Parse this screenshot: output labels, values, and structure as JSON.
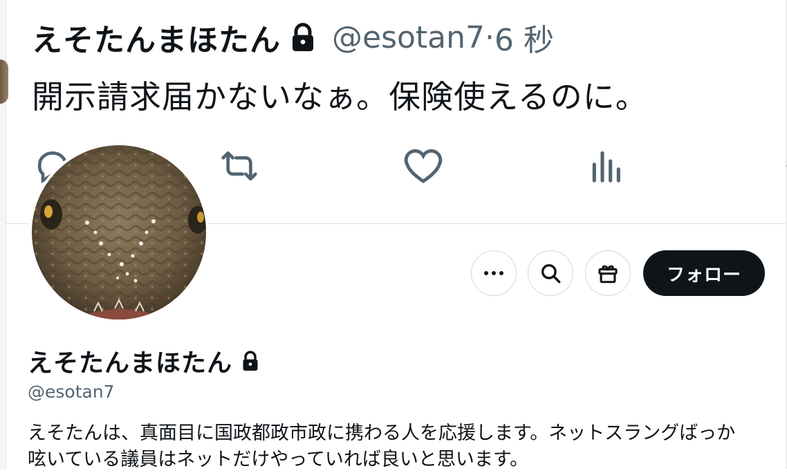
{
  "tweet": {
    "display_name": "えそたんまほたん",
    "handle": "@esotan7",
    "separator": "·",
    "time": "6 秒",
    "text": "開示請求届かないなぁ。保険使えるのに。"
  },
  "tweet_actions": {
    "icons": [
      "reply-icon",
      "retweet-icon",
      "like-icon",
      "views-icon",
      "bookmark-icon"
    ]
  },
  "profile": {
    "display_name": "えそたんまほたん",
    "handle": "@esotan7",
    "bio_line1": "えそたんは、真面目に国政都政市政に携わる人を応援します。ネットスラングばっか",
    "bio_line2": "呟いている議員はネットだけやっていれば良いと思います。",
    "follow_label": "フォロー",
    "buttons": [
      "more-icon",
      "search-icon",
      "gift-icon"
    ]
  },
  "colors": {
    "text": "#0f1419",
    "secondary": "#536471",
    "follow_bg": "#0f1419",
    "border": "#cfd9de"
  }
}
